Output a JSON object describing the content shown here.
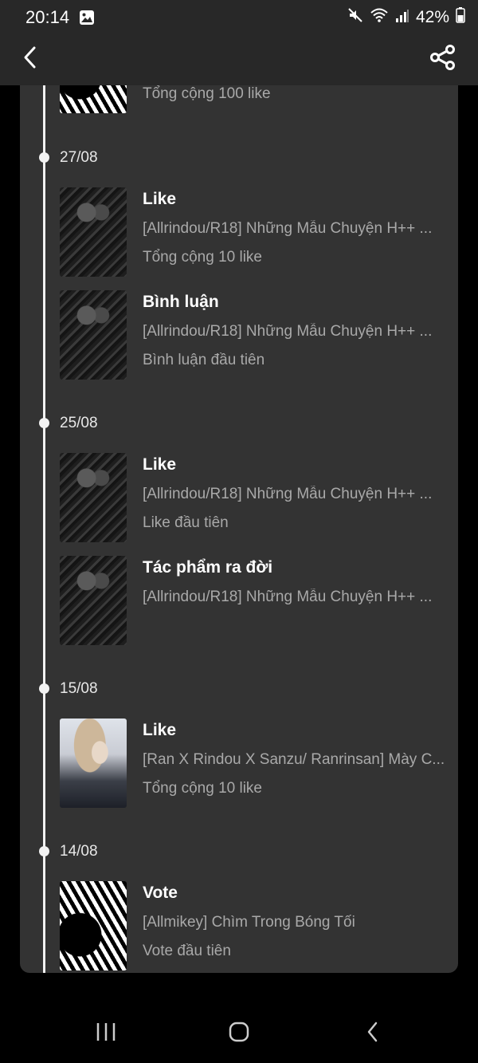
{
  "status_bar": {
    "time": "20:14",
    "battery": "42%",
    "icons": [
      "image-icon",
      "mute-icon",
      "wifi-icon",
      "signal-icon",
      "battery-icon"
    ]
  },
  "app_bar": {
    "back_icon": "chevron-left-icon",
    "share_icon": "share-icon"
  },
  "timeline": {
    "partial_entry": {
      "detail": "Tổng cộng 100 like"
    },
    "groups": [
      {
        "date": "27/08",
        "entries": [
          {
            "title": "Like",
            "story": "[Allrindou/R18] Những Mẫu Chuyện H++ ...",
            "detail": "Tổng cộng 10 like"
          },
          {
            "title": "Bình luận",
            "story": "[Allrindou/R18] Những Mẫu Chuyện H++ ...",
            "detail": "Bình luận đầu tiên"
          }
        ]
      },
      {
        "date": "25/08",
        "entries": [
          {
            "title": "Like",
            "story": "[Allrindou/R18] Những Mẫu Chuyện H++ ...",
            "detail": "Like đầu tiên"
          },
          {
            "title": "Tác phẩm ra đời",
            "story": "[Allrindou/R18] Những Mẫu Chuyện H++ ...",
            "detail": ""
          }
        ]
      },
      {
        "date": "15/08",
        "entries": [
          {
            "title": "Like",
            "story": "[Ran X Rindou X Sanzu/ Ranrinsan] Mày C...",
            "detail": "Tổng cộng 10 like"
          }
        ]
      },
      {
        "date": "14/08",
        "entries": [
          {
            "title": "Vote",
            "story": "[Allmikey] Chìm Trong Bóng Tối",
            "detail": "Vote đầu tiên"
          }
        ]
      }
    ]
  },
  "nav_bar": {
    "recents_icon": "recents-icon",
    "home_icon": "home-icon",
    "back_icon": "back-icon"
  }
}
